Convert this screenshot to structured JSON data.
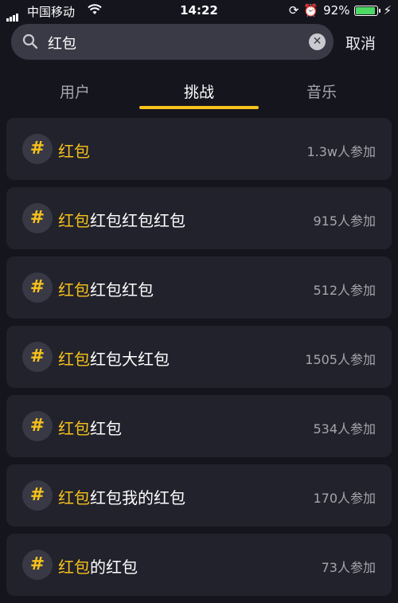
{
  "status_bar": {
    "carrier": "中国移动",
    "time": "14:22",
    "battery": "92%",
    "battery_level": 0.92
  },
  "search": {
    "query": "红包",
    "cancel_label": "取消"
  },
  "tabs": [
    {
      "label": "用户",
      "active": false
    },
    {
      "label": "挑战",
      "active": true
    },
    {
      "label": "音乐",
      "active": false
    }
  ],
  "accent_color": "#f7c21a",
  "results": [
    {
      "hash": "#",
      "highlight": "红包",
      "rest": "",
      "count": "1.3w人参加"
    },
    {
      "hash": "#",
      "highlight": "红包",
      "rest": "红包红包红包",
      "count": "915人参加"
    },
    {
      "hash": "#",
      "highlight": "红包",
      "rest": "红包红包",
      "count": "512人参加"
    },
    {
      "hash": "#",
      "highlight": "红包",
      "rest": "红包大红包",
      "count": "1505人参加"
    },
    {
      "hash": "#",
      "highlight": "红包",
      "rest": "红包",
      "count": "534人参加"
    },
    {
      "hash": "#",
      "highlight": "红包",
      "rest": "红包我的红包",
      "count": "170人参加"
    },
    {
      "hash": "#",
      "highlight": "红包",
      "rest": "的红包",
      "count": "73人参加"
    }
  ]
}
